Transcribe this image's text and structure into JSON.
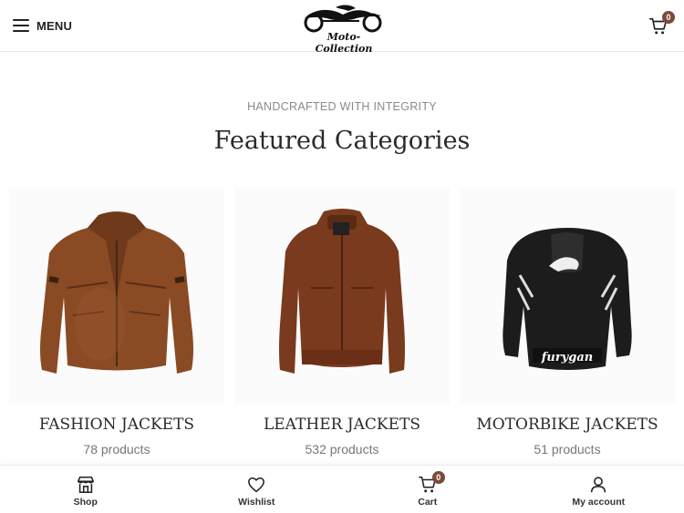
{
  "header": {
    "menu_label": "MENU",
    "logo_text": "Moto-Collection",
    "cart_count": "0"
  },
  "hero": {
    "subtitle": "HANDCRAFTED WITH INTEGRITY",
    "title": "Featured Categories"
  },
  "categories": [
    {
      "name": "FASHION JACKETS",
      "count": "78 products"
    },
    {
      "name": "LEATHER JACKETS",
      "count": "532 products"
    },
    {
      "name": "MOTORBIKE JACKETS",
      "count": "51 products"
    }
  ],
  "bottom_nav": {
    "shop": "Shop",
    "wishlist": "Wishlist",
    "cart": "Cart",
    "cart_count": "0",
    "account": "My account"
  },
  "icons": [
    "menu-icon",
    "cart-icon",
    "store-icon",
    "heart-icon",
    "user-icon"
  ],
  "colors": {
    "accent": "#7a4a3a",
    "text": "#2a2a2a"
  }
}
